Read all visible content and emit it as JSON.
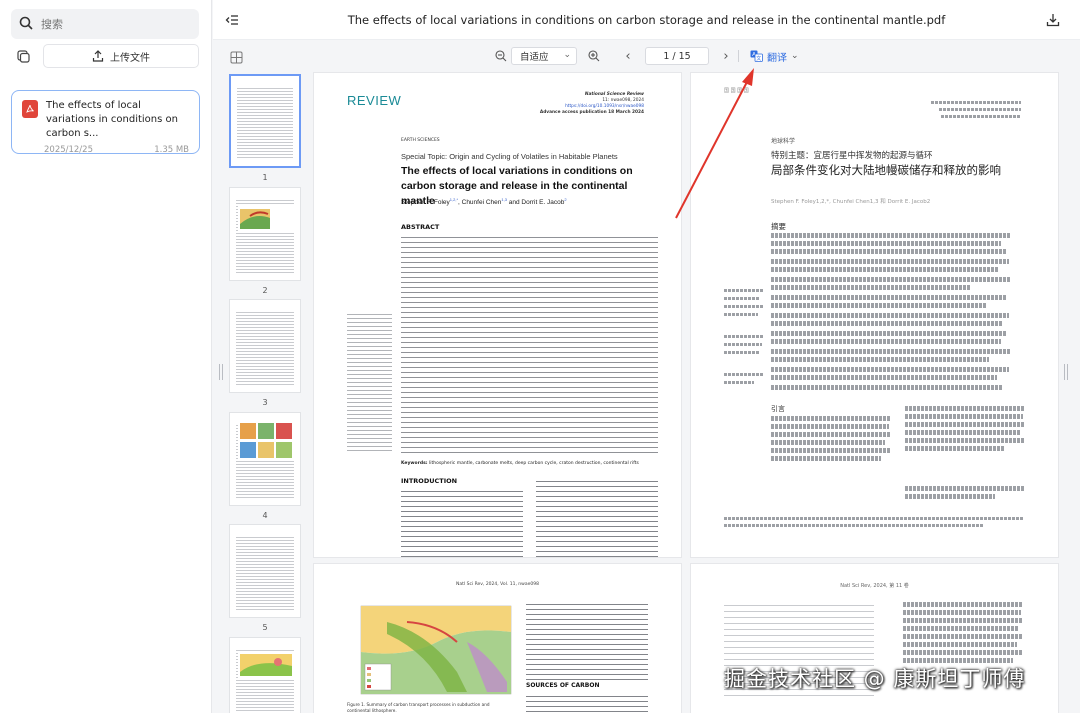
{
  "sidebar": {
    "search_placeholder": "搜索",
    "upload_label": "上传文件",
    "file": {
      "name": "The effects of local variations in conditions on carbon s...",
      "date": "2025/12/25",
      "size": "1.35 MB"
    }
  },
  "header": {
    "title": "The effects of local variations in conditions on carbon storage and release in the continental mantle.pdf"
  },
  "toolbar": {
    "zoom_value": "自适应",
    "page_indicator": "1 / 15",
    "translate_label": "翻译"
  },
  "thumbnails": [
    "1",
    "2",
    "3",
    "4",
    "5"
  ],
  "document": {
    "review_label": "REVIEW",
    "journal_name": "National Science Review",
    "journal_vol": "11: nwae098, 2024",
    "journal_doi": "https://doi.org/10.1093/nsr/nwae098",
    "journal_pub": "Advance access publication 18 March 2024",
    "section": "EARTH SCIENCES",
    "special_topic": "Special Topic: Origin and Cycling of Volatiles in Habitable Planets",
    "title": "The effects of local variations in conditions on carbon storage and release in the continental mantle",
    "authors": "Stephen F. Foley",
    "authors_sup": "1,2,*",
    "authors_2": ", Chunfei Chen",
    "authors_2_sup": "1,3",
    "authors_3": " and Dorrit E. Jacob",
    "authors_3_sup": "2",
    "abstract_heading": "ABSTRACT",
    "keywords_label": "Keywords:",
    "keywords": "lithospheric mantle, carbonate melts, deep carbon cycle, craton destruction, continental rifts",
    "intro_heading": "INTRODUCTION",
    "page2_header": "Natl Sci Rev, 2024, Vol. 11, nwae098",
    "figure_caption": "Figure 1. Summary of carbon transport processes in subduction and continental lithosphere.",
    "sources_heading": "SOURCES OF CARBON"
  },
  "translation": {
    "section": "地球科学",
    "special_topic": "特别主题：宜居行星中挥发物的起源与循环",
    "title": "局部条件变化对大陆地幔碳储存和释放的影响",
    "authors": "Stephen F. Foley1,2,*, Chunfei Chen1,3 和 Dorrit E. Jacob2",
    "abstract_heading": "摘要",
    "references_heading": "引言",
    "page2_header": "Natl Sci Rev, 2024, 第 11 卷"
  },
  "watermark": "掘金技术社区 @ 康斯坦丁师傅"
}
